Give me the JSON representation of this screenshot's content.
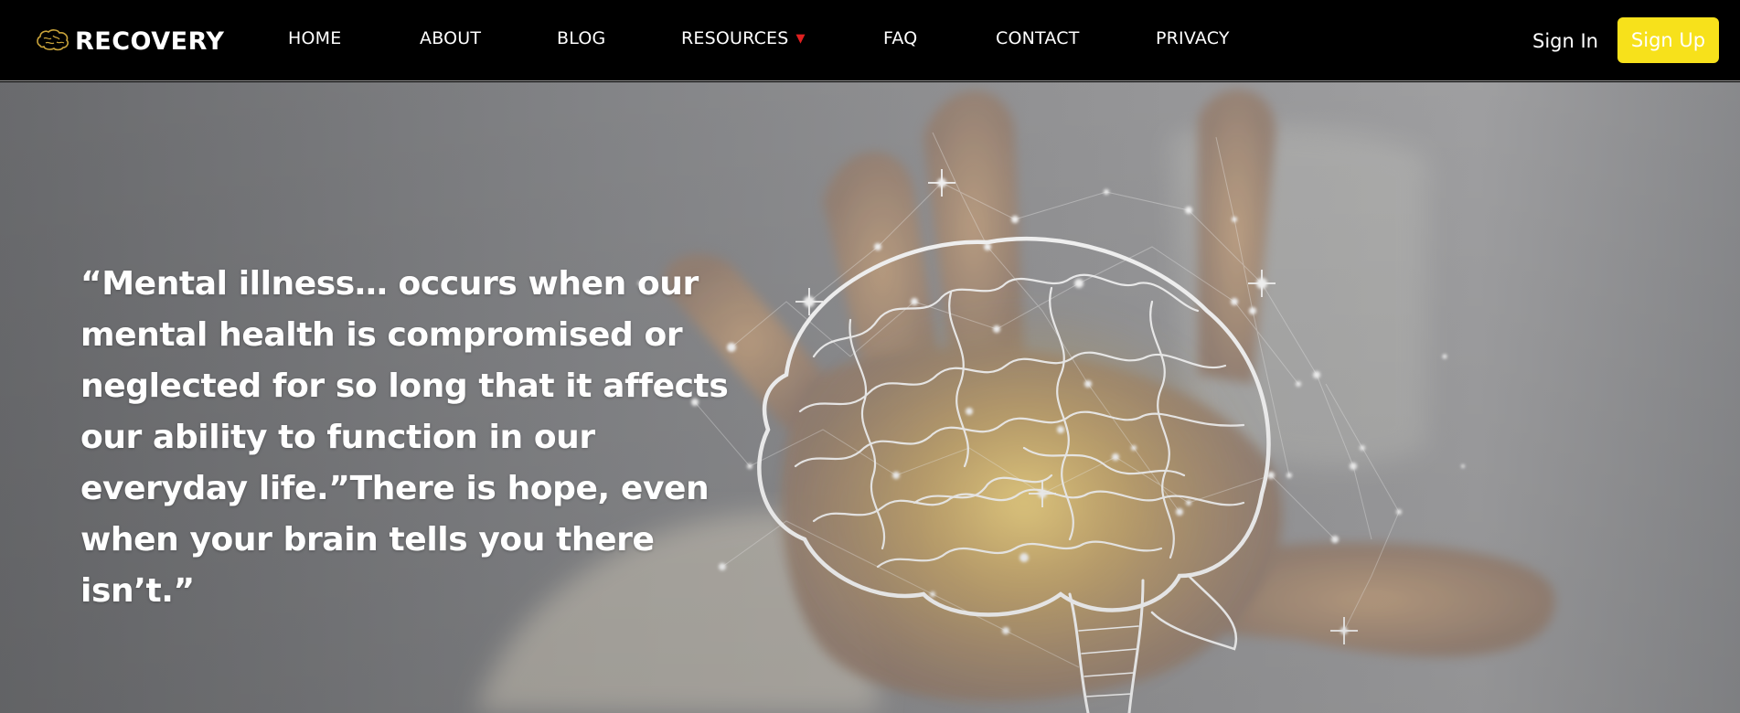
{
  "brand": {
    "name": "RECOVERY",
    "icon": "brain-icon"
  },
  "nav": {
    "items": [
      {
        "label": "HOME"
      },
      {
        "label": "ABOUT"
      },
      {
        "label": "BLOG"
      },
      {
        "label": "RESOURCES",
        "has_dropdown": true
      },
      {
        "label": "FAQ"
      },
      {
        "label": "CONTACT"
      },
      {
        "label": "PRIVACY"
      }
    ],
    "dropdown_icon": "caret-down-icon",
    "signin_label": "Sign In",
    "signup_label": "Sign Up"
  },
  "hero": {
    "quote": "“Mental illness… occurs when our mental health is compromised or neglected for so long that it affects our ability to function in our everyday life.”There is hope, even when your brain tells you there isn’t.”",
    "image": "glowing-brain-over-hand"
  },
  "colors": {
    "navbar_bg": "#000000",
    "accent": "#f7e11b",
    "caret": "#e02020",
    "hero_bg": "#7c7d80"
  }
}
